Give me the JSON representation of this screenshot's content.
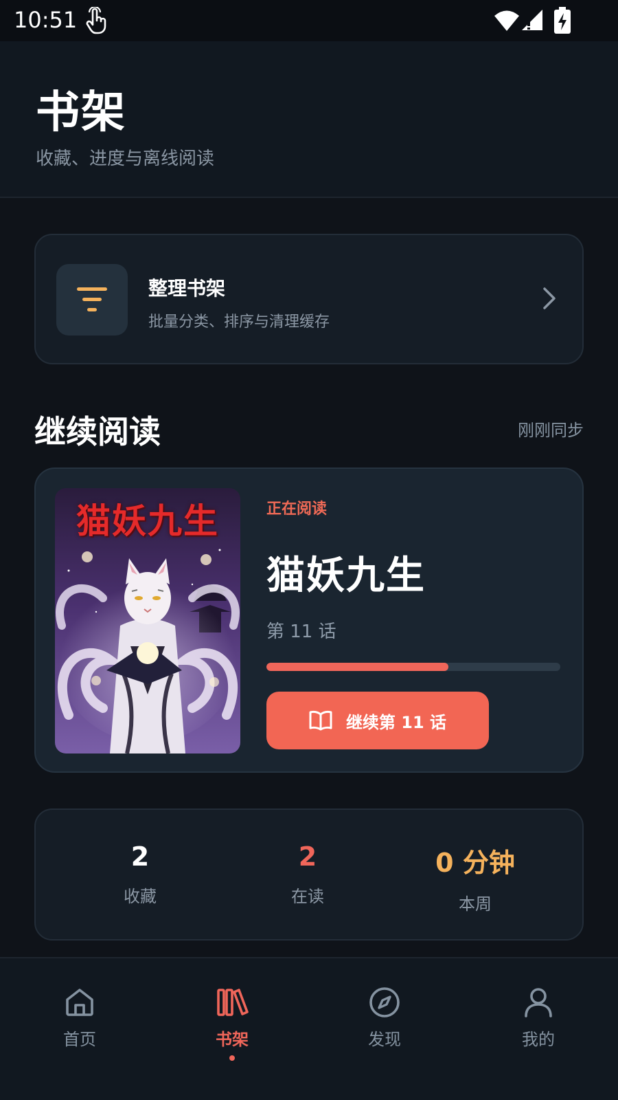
{
  "status_bar": {
    "time": "10:51"
  },
  "header": {
    "title": "书架",
    "subtitle": "收藏、进度与离线阅读"
  },
  "organize": {
    "title": "整理书架",
    "description": "批量分类、排序与清理缓存",
    "icon": "filter-icon"
  },
  "continue_reading": {
    "section_title": "继续阅读",
    "sync_status": "刚刚同步",
    "book": {
      "cover_title": "猫妖九生",
      "badge": "正在阅读",
      "title": "猫妖九生",
      "chapter": "第 11 话",
      "progress": 0.62,
      "button_label": "继续第 11 话"
    }
  },
  "stats": [
    {
      "value": "2",
      "label": "收藏",
      "color": "#ffffff"
    },
    {
      "value": "2",
      "label": "在读",
      "color": "#f0665a"
    },
    {
      "value": "0 分钟",
      "label": "本周",
      "color": "#f5b25c"
    }
  ],
  "bottom_nav": [
    {
      "label": "首页",
      "icon": "home-icon",
      "active": false
    },
    {
      "label": "书架",
      "icon": "bookshelf-icon",
      "active": true
    },
    {
      "label": "发现",
      "icon": "compass-icon",
      "active": false
    },
    {
      "label": "我的",
      "icon": "user-icon",
      "active": false
    }
  ],
  "colors": {
    "accent": "#f0665a",
    "background": "#0f1319",
    "card": "#1a2530",
    "highlight": "#f5b25c"
  }
}
